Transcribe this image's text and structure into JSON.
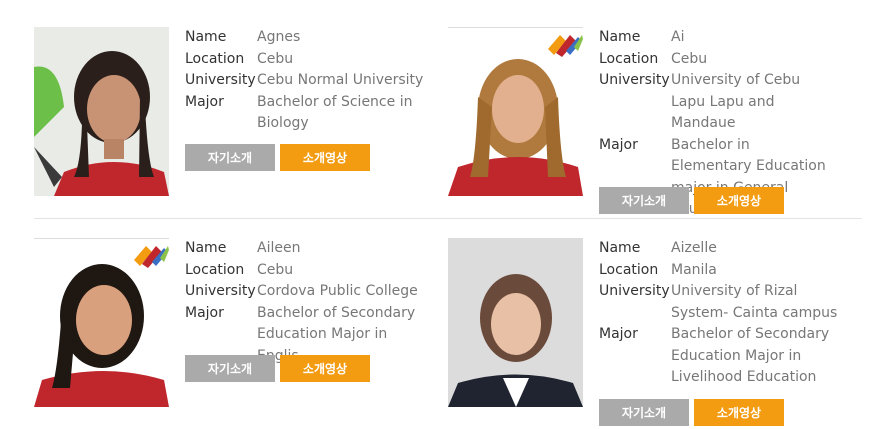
{
  "labels": {
    "name": "Name",
    "location": "Location",
    "university": "University",
    "major": "Major"
  },
  "buttons": {
    "intro": "자기소개",
    "video": "소개영상"
  },
  "colors": {
    "intro_button": "#aaaaaa",
    "video_button": "#f39c12",
    "shirt": "#c0272d"
  },
  "profiles": [
    {
      "name": "Agnes",
      "location": "Cebu",
      "university": "Cebu Normal University",
      "major": "Bachelor of Science in Biology"
    },
    {
      "name": "Ai",
      "location": "Cebu",
      "university": "University of Cebu Lapu Lapu and Mandaue",
      "major": "Bachelor in Elementary Education major in General Education"
    },
    {
      "name": "Aileen",
      "location": "Cebu",
      "university": "Cordova Public College",
      "major": "Bachelor of Secondary Education Major in Englis"
    },
    {
      "name": "Aizelle",
      "location": "Manila",
      "university": "University of Rizal System- Cainta campus",
      "major": "Bachelor of Secondary Education Major in Livelihood Education"
    }
  ]
}
